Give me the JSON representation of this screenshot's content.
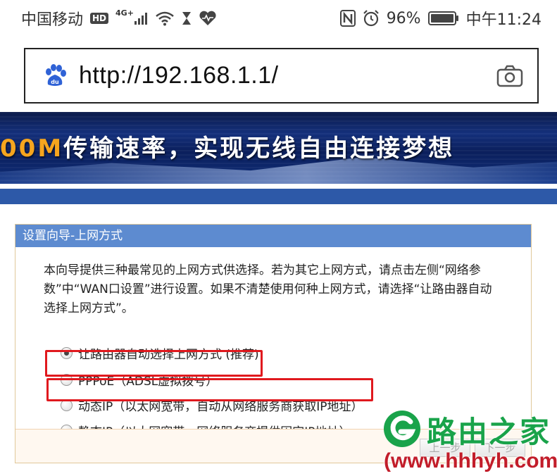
{
  "status_bar": {
    "carrier": "中国移动",
    "hd": "HD",
    "network": "4G+",
    "battery": "96%",
    "time": "中午11:24"
  },
  "browser": {
    "url": "http://192.168.1.1/",
    "icons": {
      "site": "baidu-paw-icon",
      "camera": "camera-icon"
    }
  },
  "banner": {
    "highlight": "00M",
    "text": "传输速率，实现无线自由连接梦想"
  },
  "panel": {
    "title": "设置向导-上网方式",
    "intro": "本向导提供三种最常见的上网方式供选择。若为其它上网方式，请点击左侧“网络参数”中“WAN口设置”进行设置。如果不清楚使用何种上网方式，请选择“让路由器自动选择上网方式”。",
    "options": [
      {
        "label": "让路由器自动选择上网方式 (推荐)",
        "selected": true
      },
      {
        "label": "PPPoE（ADSL虚拟拨号）",
        "selected": false
      },
      {
        "label": "动态IP（以太网宽带，自动从网络服务商获取IP地址）",
        "selected": false
      },
      {
        "label": "静态IP（以太网宽带，网络服务商提供固定IP地址）",
        "selected": false
      }
    ],
    "buttons": {
      "prev": "上一步",
      "next": "下一步"
    }
  },
  "watermark": {
    "title": "路由之家",
    "url": "(www.hhhyh.com)"
  },
  "colors": {
    "panel_title_bg": "#5d8bd0",
    "highlight_red": "#e0191e",
    "watermark_green": "#19a34a",
    "watermark_red": "#c21d2a"
  }
}
